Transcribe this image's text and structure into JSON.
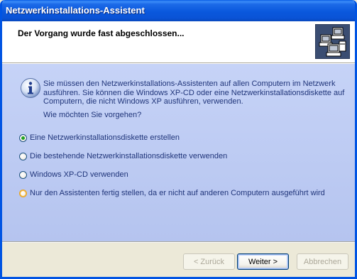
{
  "window": {
    "title": "Netzwerkinstallations-Assistent"
  },
  "header": {
    "title": "Der Vorgang wurde fast abgeschlossen...",
    "icon": "network-computers-icon"
  },
  "info": {
    "icon": "info-icon",
    "text": "Sie müssen den Netzwerkinstallations-Assistenten auf allen Computern im Netzwerk ausführen. Sie können die Windows XP-CD oder eine Netzwerkinstallationsdiskette auf Computern, die nicht Windows XP ausführen, verwenden.",
    "question": "Wie möchten Sie vorgehen?"
  },
  "options": [
    {
      "label": "Eine Netzwerkinstallationsdiskette erstellen",
      "selected": true
    },
    {
      "label": "Die bestehende Netzwerkinstallationsdiskette verwenden",
      "selected": false
    },
    {
      "label": "Windows XP-CD verwenden",
      "selected": false
    },
    {
      "label": "Nur den Assistenten fertig stellen, da er nicht auf anderen Computern ausgeführt wird",
      "selected": false
    }
  ],
  "buttons": {
    "back": "< Zurück",
    "next": "Weiter >",
    "cancel": "Abbrechen"
  },
  "colors": {
    "title_bar": "#0A53D6",
    "content_bg": "#C6D3F7",
    "text": "#20357A",
    "selected_dot": "#21A121"
  }
}
